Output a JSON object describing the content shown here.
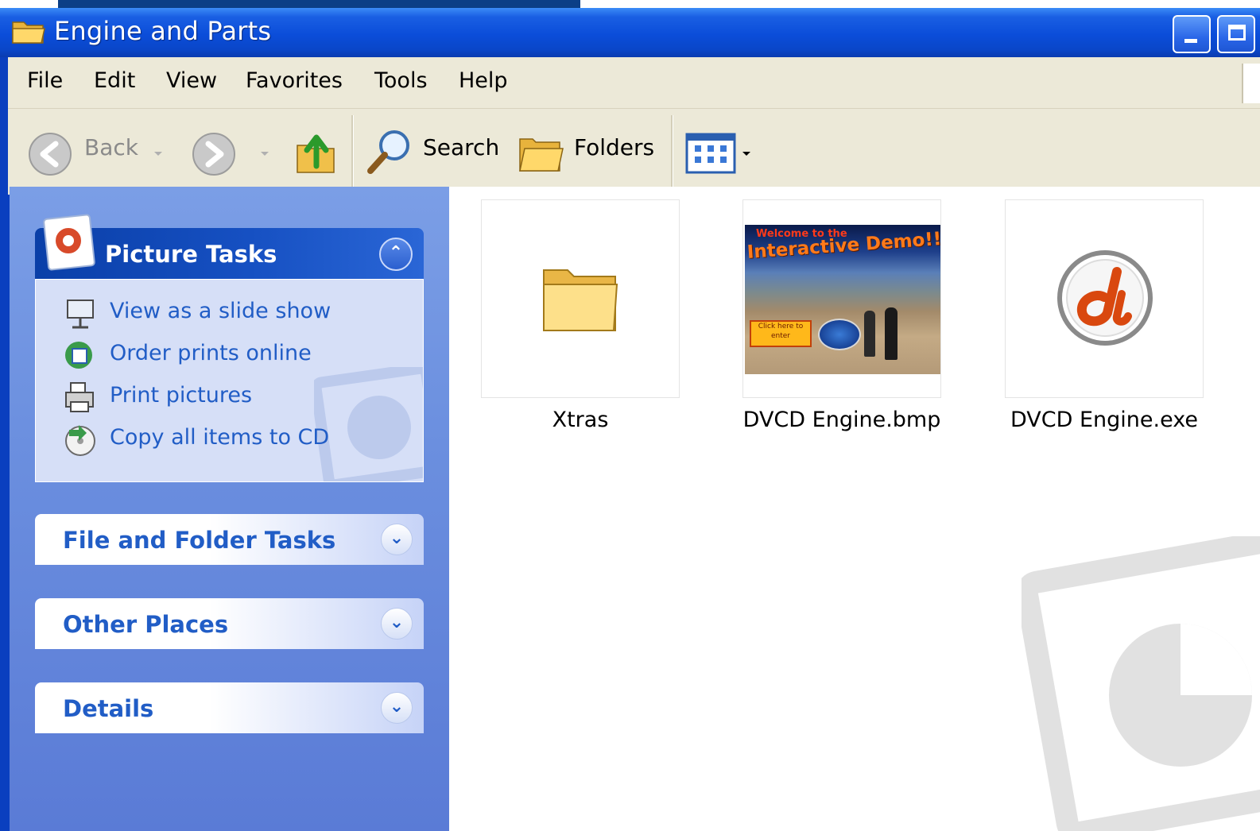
{
  "window": {
    "title": "Engine and Parts",
    "icon": "folder-open-icon",
    "controls": [
      "minimize-icon",
      "maximize-icon"
    ]
  },
  "menu": [
    "File",
    "Edit",
    "View",
    "Favorites",
    "Tools",
    "Help"
  ],
  "toolbar": {
    "back_label": "Back",
    "search_label": "Search",
    "folders_label": "Folders",
    "icons": [
      "back-arrow-icon",
      "forward-arrow-icon",
      "up-folder-icon",
      "search-magnifier-icon",
      "folders-icon",
      "views-icon"
    ]
  },
  "sidebar": {
    "picture_tasks": {
      "title": "Picture Tasks",
      "tasks": [
        {
          "label": "View as a slide show",
          "icon": "slideshow-icon"
        },
        {
          "label": "Order prints online",
          "icon": "order-prints-icon"
        },
        {
          "label": "Print pictures",
          "icon": "printer-icon"
        },
        {
          "label": "Copy all items to CD",
          "icon": "cd-copy-icon"
        }
      ]
    },
    "file_folder_tasks": {
      "title": "File and Folder Tasks"
    },
    "other_places": {
      "title": "Other Places"
    },
    "details": {
      "title": "Details"
    }
  },
  "files": [
    {
      "name": "Xtras",
      "type": "folder",
      "icon": "folder-icon"
    },
    {
      "name": "DVCD Engine.bmp",
      "type": "image",
      "preview_title": "Welcome to the",
      "preview_headline": "Interactive Demo!!!",
      "preview_button": "Click here to enter"
    },
    {
      "name": "DVCD Engine.exe",
      "type": "application",
      "icon": "director-app-icon"
    }
  ],
  "colors": {
    "titlebar": "#0b4dd9",
    "task_panel": "#6b8fdf",
    "task_link": "#215dc6",
    "menubar": "#ece9d8"
  }
}
